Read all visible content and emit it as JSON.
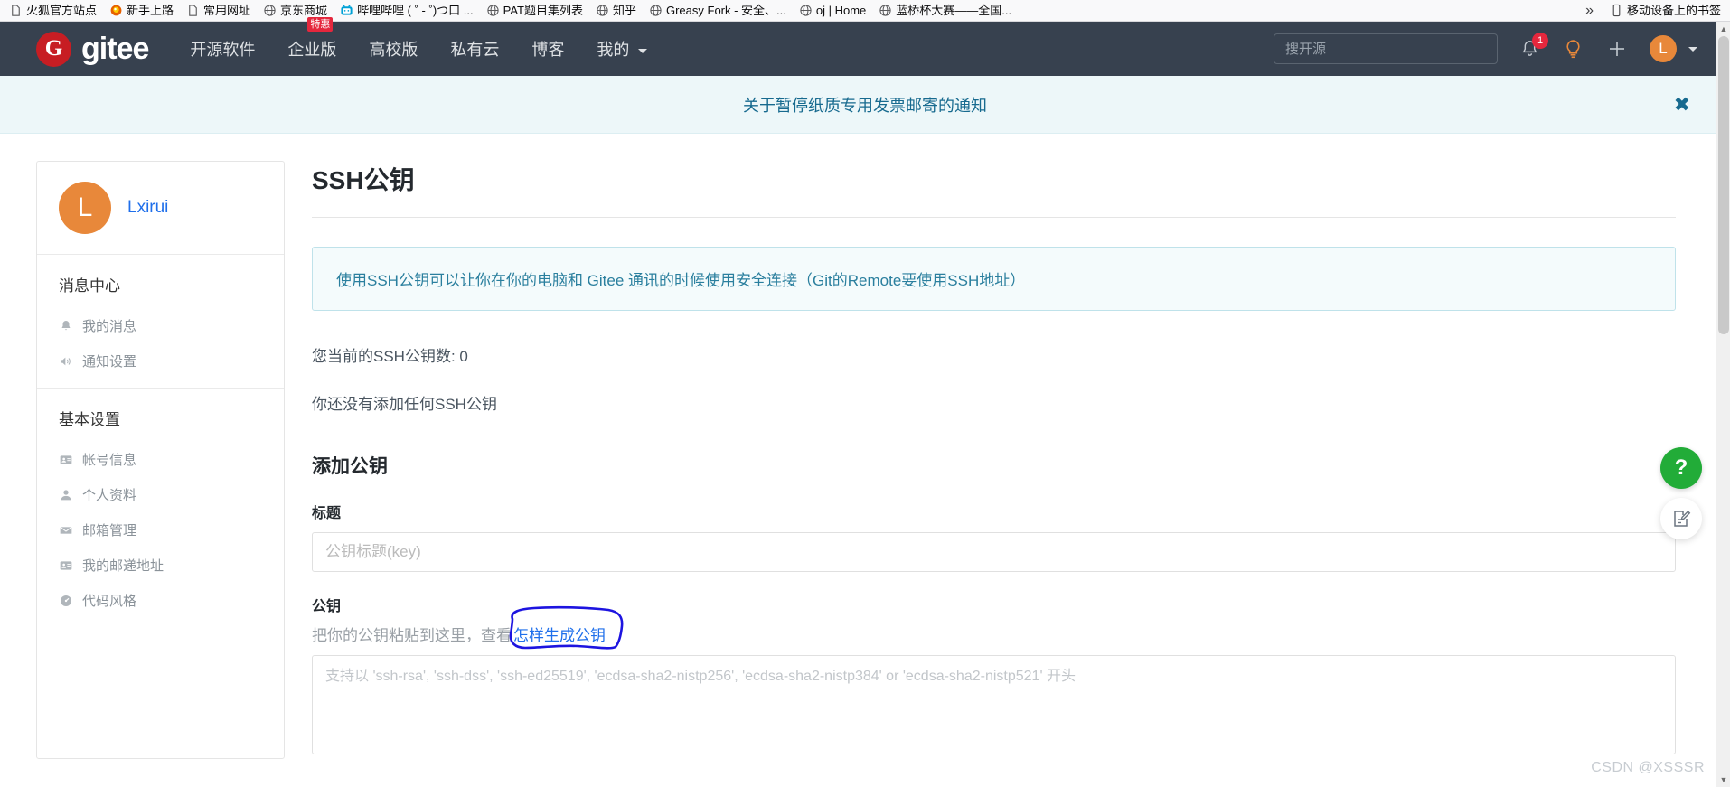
{
  "browser": {
    "bookmarks": [
      {
        "label": "火狐官方站点",
        "icon": "document-icon"
      },
      {
        "label": "新手上路",
        "icon": "firefox-icon"
      },
      {
        "label": "常用网址",
        "icon": "document-icon"
      },
      {
        "label": "京东商城",
        "icon": "globe-icon"
      },
      {
        "label": "哔哩哔哩 ( ˚ - ˚)つ口 ...",
        "icon": "bilibili-icon"
      },
      {
        "label": "PAT题目集列表",
        "icon": "globe-icon"
      },
      {
        "label": "知乎",
        "icon": "globe-icon"
      },
      {
        "label": "Greasy Fork - 安全、...",
        "icon": "globe-icon"
      },
      {
        "label": "oj | Home",
        "icon": "globe-icon"
      },
      {
        "label": "蓝桥杯大赛——全国...",
        "icon": "globe-icon"
      }
    ],
    "overflow_label": "»",
    "mobile_bookmarks": {
      "label": "移动设备上的书签",
      "icon": "mobile-icon"
    }
  },
  "header": {
    "logo_mark": "G",
    "logo_text": "gitee",
    "nav": [
      {
        "label": "开源软件",
        "badge": ""
      },
      {
        "label": "企业版",
        "badge": "特惠"
      },
      {
        "label": "高校版",
        "badge": ""
      },
      {
        "label": "私有云",
        "badge": ""
      },
      {
        "label": "博客",
        "badge": ""
      },
      {
        "label": "我的",
        "badge": "",
        "has_caret": true
      }
    ],
    "search_placeholder": "搜开源",
    "notification_count": "1",
    "avatar_initial": "L",
    "accent_color": "#c71d23",
    "background_color": "#37414f",
    "avatar_color": "#e8883a"
  },
  "notice": {
    "text": "关于暂停纸质专用发票邮寄的通知",
    "close_label": "✖"
  },
  "sidebar": {
    "username": "Lxirui",
    "avatar_initial": "L",
    "sections": [
      {
        "title": "消息中心",
        "items": [
          {
            "label": "我的消息",
            "icon": "bell-icon"
          },
          {
            "label": "通知设置",
            "icon": "speaker-icon"
          }
        ]
      },
      {
        "title": "基本设置",
        "items": [
          {
            "label": "帐号信息",
            "icon": "id-card-icon"
          },
          {
            "label": "个人资料",
            "icon": "person-icon"
          },
          {
            "label": "邮箱管理",
            "icon": "envelope-icon"
          },
          {
            "label": "我的邮递地址",
            "icon": "address-card-icon"
          },
          {
            "label": "代码风格",
            "icon": "gauge-icon"
          }
        ]
      }
    ]
  },
  "main": {
    "page_title": "SSH公钥",
    "info_text": "使用SSH公钥可以让你在你的电脑和 Gitee 通讯的时候使用安全连接（Git的Remote要使用SSH地址）",
    "key_count_text": "您当前的SSH公钥数: 0",
    "empty_text": "你还没有添加任何SSH公钥",
    "add_section_title": "添加公钥",
    "title_field": {
      "label": "标题",
      "value": "",
      "placeholder": "公钥标题(key)"
    },
    "key_field": {
      "label": "公钥",
      "hint_prefix": "把你的公钥粘贴到这里，查看",
      "hint_link": "怎样生成公钥",
      "value": "",
      "placeholder": "支持以 'ssh-rsa', 'ssh-dss', 'ssh-ed25519', 'ecdsa-sha2-nistp256', 'ecdsa-sha2-nistp384' or 'ecdsa-sha2-nistp521' 开头"
    }
  },
  "widgets": {
    "help_label": "?",
    "help_color": "#22ac38",
    "feedback_icon": "edit-note-icon"
  },
  "watermark": "CSDN @XSSSR"
}
